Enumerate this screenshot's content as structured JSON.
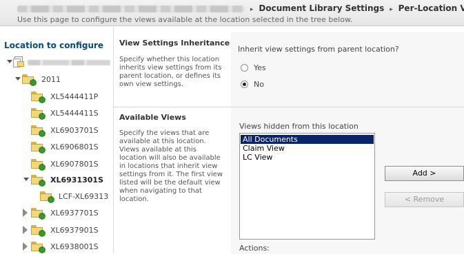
{
  "breadcrumb": {
    "items": [
      "Document Library Settings",
      "Per-Location Vie"
    ],
    "separator": "▸",
    "description": "Use this page to configure the views available at the location selected in the tree below."
  },
  "tree": {
    "title": "Location to configure",
    "nodes": [
      {
        "label": "2011"
      },
      {
        "label": "XL5444411P"
      },
      {
        "label": "XL5444411S"
      },
      {
        "label": "XL6903701S"
      },
      {
        "label": "XL6906801S"
      },
      {
        "label": "XL6907801S"
      },
      {
        "label": "XL6931301S"
      },
      {
        "label": "LCF-XL69313"
      },
      {
        "label": "XL6937701S"
      },
      {
        "label": "XL6937901S"
      },
      {
        "label": "XL6938001S"
      }
    ]
  },
  "inheritance": {
    "title": "View Settings Inheritance",
    "description": "Specify whether this location inherits view settings from its parent location, or defines its own view settings.",
    "question": "Inherit view settings from parent location?",
    "options": [
      "Yes",
      "No"
    ],
    "selected": "No"
  },
  "available_views": {
    "title": "Available Views",
    "description": "Specify the views that are available at this location. Views available at this location will also be available in locations that inherit view settings from it. The first view listed will be the default view when navigating to that location.",
    "hidden_label": "Views hidden from this location",
    "hidden_views": [
      "All Documents",
      "Claim View",
      "LC View"
    ],
    "selected_view": "All Documents",
    "add_label": "Add >",
    "remove_label": "< Remove",
    "actions_label": "Actions:"
  },
  "colors": {
    "tree_title": "#004d7f",
    "selection": "#0a246a"
  }
}
